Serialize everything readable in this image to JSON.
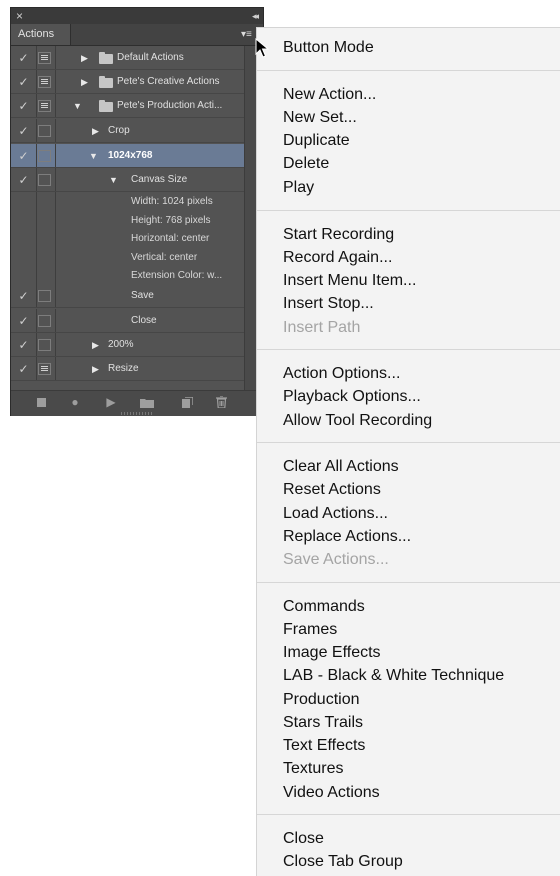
{
  "panel": {
    "tab": "Actions",
    "close_glyph": "×",
    "collapse_glyph": "◂◂",
    "menu_glyph": "▾≡",
    "rows": [
      {
        "label": "Default Actions",
        "checked": true,
        "dialog": true,
        "expanded": false,
        "type": "set"
      },
      {
        "label": "Pete's Creative Actions",
        "checked": true,
        "dialog": true,
        "expanded": false,
        "type": "set"
      },
      {
        "label": "Pete's Production Acti...",
        "checked": true,
        "dialog": true,
        "expanded": true,
        "type": "set"
      },
      {
        "label": "Crop",
        "checked": true,
        "dialog": false,
        "expanded": false,
        "type": "action"
      },
      {
        "label": "1024x768",
        "checked": true,
        "dialog": false,
        "expanded": true,
        "type": "action",
        "selected": true
      },
      {
        "label": "Canvas Size",
        "checked": true,
        "dialog": false,
        "expanded": true,
        "type": "step"
      },
      {
        "label": "Save",
        "checked": true,
        "dialog": false,
        "type": "step"
      },
      {
        "label": "Close",
        "checked": true,
        "dialog": false,
        "type": "step"
      },
      {
        "label": "200%",
        "checked": true,
        "dialog": false,
        "expanded": false,
        "type": "action"
      },
      {
        "label": "Resize",
        "checked": true,
        "dialog": true,
        "expanded": false,
        "type": "action"
      }
    ],
    "canvas_details": [
      "Width: 1024 pixels",
      "Height: 768 pixels",
      "Horizontal: center",
      "Vertical: center",
      "Extension Color: w..."
    ],
    "bottom_icons": [
      "stop-icon",
      "record-icon",
      "play-icon",
      "new-set-icon",
      "new-action-icon",
      "delete-icon"
    ],
    "colors": {
      "panel_bg": "#535353",
      "selected_row": "#6a7b95",
      "menu_bg": "#f3f3f3"
    }
  },
  "menu": {
    "groups": [
      [
        "Button Mode"
      ],
      [
        "New Action...",
        "New Set...",
        "Duplicate",
        "Delete",
        "Play"
      ],
      [
        "Start Recording",
        "Record Again...",
        "Insert Menu Item...",
        "Insert Stop...",
        "Insert Path"
      ],
      [
        "Action Options...",
        "Playback Options...",
        "Allow Tool Recording"
      ],
      [
        "Clear All Actions",
        "Reset Actions",
        "Load Actions...",
        "Replace Actions...",
        "Save Actions..."
      ],
      [
        "Commands",
        "Frames",
        "Image Effects",
        "LAB - Black & White Technique",
        "Production",
        "Stars Trails",
        "Text Effects",
        "Textures",
        "Video Actions"
      ],
      [
        "Close",
        "Close Tab Group"
      ]
    ],
    "disabled": [
      "Insert Path",
      "Save Actions..."
    ]
  }
}
